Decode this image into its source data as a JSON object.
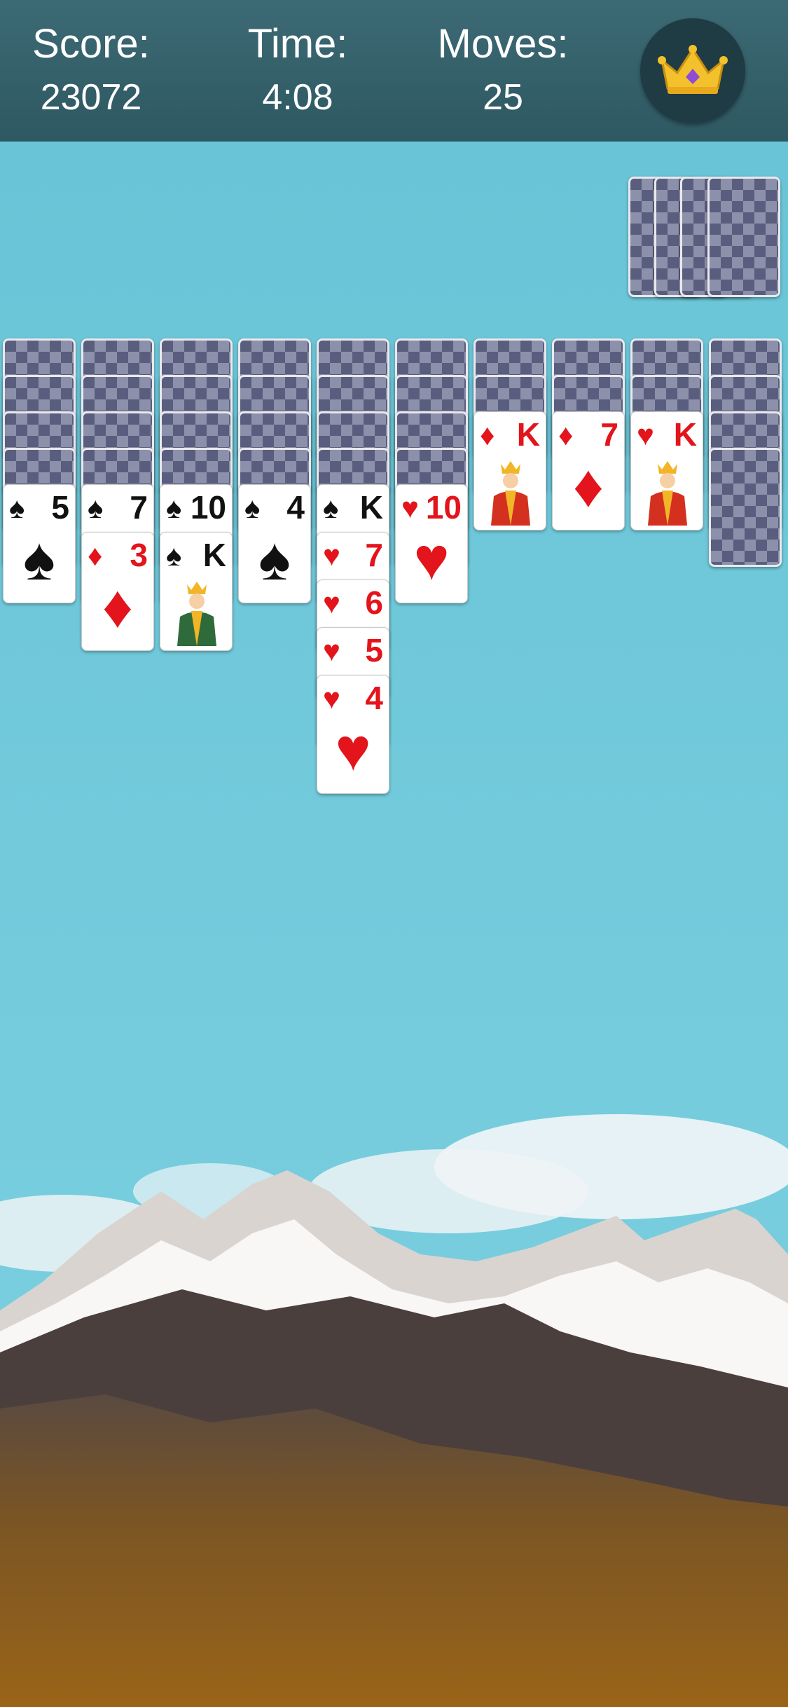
{
  "header": {
    "score_label": "Score:",
    "score_value": "23072",
    "time_label": "Time:",
    "time_value": "4:08",
    "moves_label": "Moves:",
    "moves_value": "25",
    "crown_icon": "crown-icon"
  },
  "colors": {
    "header_bg": "#2e5862",
    "sky": "#6cc6d8",
    "card_back": "#5a5e7e",
    "red_suit": "#e3141b",
    "black_suit": "#111111"
  },
  "stock": {
    "face_down_piles": 4
  },
  "tableau": [
    {
      "face_down": 4,
      "face_up": [
        {
          "rank": "5",
          "suit": "♠",
          "color": "black"
        }
      ]
    },
    {
      "face_down": 4,
      "face_up": [
        {
          "rank": "7",
          "suit": "♠",
          "color": "black"
        },
        {
          "rank": "3",
          "suit": "♦",
          "color": "red"
        }
      ]
    },
    {
      "face_down": 4,
      "face_up": [
        {
          "rank": "10",
          "suit": "♠",
          "color": "black"
        },
        {
          "rank": "K",
          "suit": "♠",
          "color": "black"
        }
      ]
    },
    {
      "face_down": 4,
      "face_up": [
        {
          "rank": "4",
          "suit": "♠",
          "color": "black"
        }
      ]
    },
    {
      "face_down": 4,
      "face_up": [
        {
          "rank": "K",
          "suit": "♠",
          "color": "black"
        },
        {
          "rank": "7",
          "suit": "♥",
          "color": "red"
        },
        {
          "rank": "6",
          "suit": "♥",
          "color": "red"
        },
        {
          "rank": "5",
          "suit": "♥",
          "color": "red"
        },
        {
          "rank": "4",
          "suit": "♥",
          "color": "red"
        }
      ]
    },
    {
      "face_down": 4,
      "face_up": [
        {
          "rank": "10",
          "suit": "♥",
          "color": "red"
        }
      ]
    },
    {
      "face_down": 2,
      "face_up": [
        {
          "rank": "K",
          "suit": "♦",
          "color": "red"
        }
      ]
    },
    {
      "face_down": 2,
      "face_up": [
        {
          "rank": "7",
          "suit": "♦",
          "color": "red"
        }
      ]
    },
    {
      "face_down": 2,
      "face_up": [
        {
          "rank": "K",
          "suit": "♥",
          "color": "red"
        }
      ]
    },
    {
      "face_down": 4,
      "face_up": []
    }
  ]
}
